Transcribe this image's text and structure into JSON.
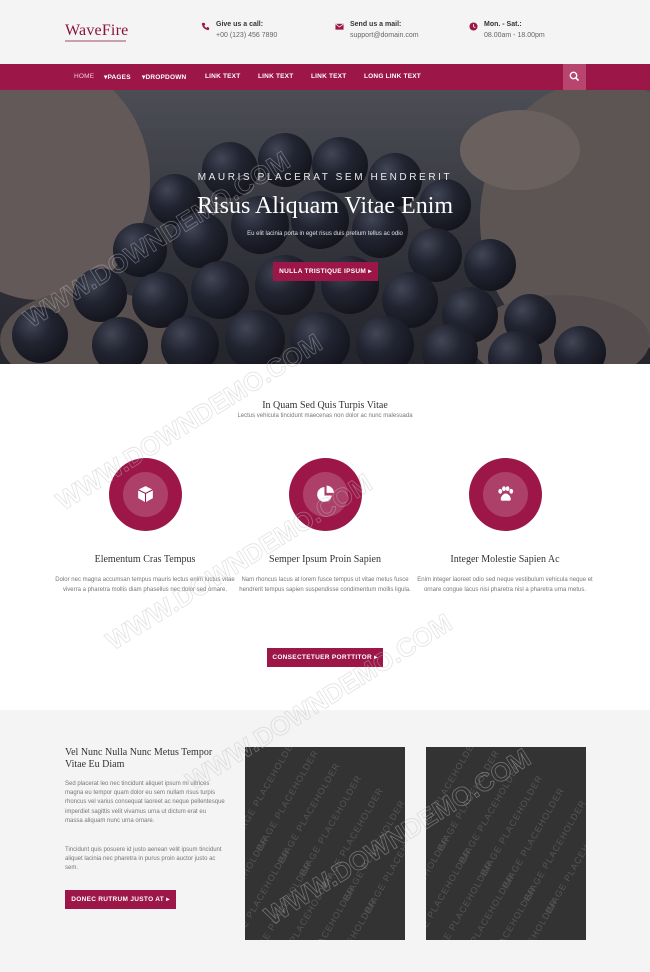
{
  "brand": {
    "name": "WaveFire"
  },
  "contacts": [
    {
      "label": "Give us a call:",
      "value": "+00 (123) 456 7890",
      "icon": "phone-icon"
    },
    {
      "label": "Send us a mail:",
      "value": "support@domain.com",
      "icon": "mail-icon"
    },
    {
      "label": "Mon. - Sat.:",
      "value": "08.00am - 18.00pm",
      "icon": "clock-icon"
    }
  ],
  "nav": {
    "items": [
      "HOME",
      "PAGES",
      "DROPDOWN",
      "LINK TEXT",
      "LINK TEXT",
      "LINK TEXT",
      "LONG LINK TEXT"
    ],
    "active": "HOME",
    "search_icon": "search-icon"
  },
  "hero": {
    "subtitle": "MAURIS PLACERAT SEM HENDRERIT",
    "title": "Risus Aliquam Vitae Enim",
    "desc": "Eu elit lacinia porta in eget risus duis pretium tellus ac odio",
    "button": "NULLA TRISTIQUE IPSUM"
  },
  "features_section": {
    "title": "In Quam Sed Quis Turpis Vitae",
    "subtitle": "Lectus vehicula tincidunt maecenas non dolor ac nunc malesuada",
    "items": [
      {
        "icon": "box-icon",
        "title": "Elementum Cras Tempus",
        "text": "Dolor nec magna accumsan tempus mauris lectus enim luctus vitae viverra a pharetra mollis diam phasellus nec dolor sed ornare."
      },
      {
        "icon": "pie-chart-icon",
        "title": "Semper Ipsum Proin Sapien",
        "text": "Nam rhoncus lacus at lorem fusce tempus ut vitae metus fusce hendrerit tempus sapien suspendisse condimentum mollis ligula."
      },
      {
        "icon": "paw-icon",
        "title": "Integer Molestie Sapien Ac",
        "text": "Enim integer laoreet odio sed neque vestibulum vehicula neque et ornare congue lacus nisi pharetra nisl a pharetra urna metus."
      }
    ],
    "button": "CONSECTETUER PORTTITOR"
  },
  "bottom": {
    "title": "Vel Nunc Nulla Nunc Metus Tempor Vitae Eu Diam",
    "para1": "Sed placerat leo nec tincidunt aliquet ipsum mi ultrices magna eu tempor quam dolor eu sem nullam risus turpis rhoncus vel varius consequat laoreet ac neque pellentesque imperdiet sagittis velit vivamus urna ut dictum erat eu massa aliquam nunc urna ornare.",
    "para2": "Tincidunt quis posuere id justo aenean velit ipsum tincidunt aliquet lacinia nec pharetra in purus proin auctor justo ac sem.",
    "button": "DONEC RUTRUM JUSTO AT",
    "placeholder_text": "IMAGE PLACEHOLDER"
  },
  "watermark": "WWW.DOWNDEMO.COM",
  "colors": {
    "accent": "#9c1747",
    "accent_light": "#b7456d",
    "topbar_bg": "#f4f4f4",
    "hero_overlay": "#3b3c44"
  }
}
